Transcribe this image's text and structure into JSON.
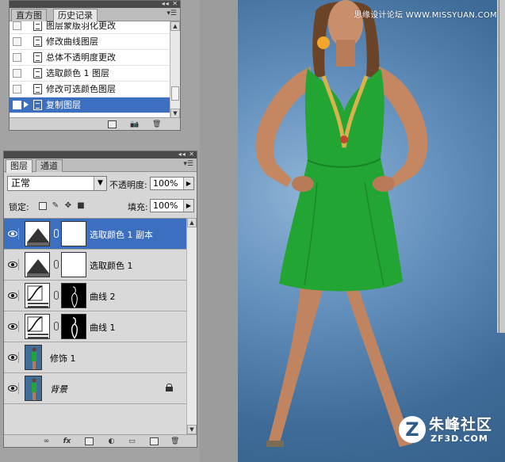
{
  "watermark": {
    "top_text": "思缘设计论坛 WWW.MISSYUAN.COM",
    "logo_letter": "Z",
    "logo_cn": "朱峰社区",
    "logo_url": "ZF3D.COM"
  },
  "history_panel": {
    "tabs": [
      "直方图",
      "历史记录"
    ],
    "active_tab": 1,
    "items": [
      {
        "label": "图层蒙版羽化更改",
        "selected": false
      },
      {
        "label": "修改曲线图层",
        "selected": false
      },
      {
        "label": "总体不透明度更改",
        "selected": false
      },
      {
        "label": "选取颜色 1 图层",
        "selected": false
      },
      {
        "label": "修改可选颜色图层",
        "selected": false
      },
      {
        "label": "复制图层",
        "selected": true
      }
    ],
    "footer_icons": [
      "new-document-from-state-icon",
      "snapshot-camera-icon",
      "trash-icon"
    ]
  },
  "layers_panel": {
    "tabs": [
      "图层",
      "通道"
    ],
    "active_tab": 0,
    "blend_mode": "正常",
    "opacity_label": "不透明度:",
    "opacity_value": "100%",
    "lock_label": "锁定:",
    "fill_label": "填充:",
    "fill_value": "100%",
    "layers": [
      {
        "name": "选取颜色 1 副本",
        "type": "selective-color",
        "selected": true
      },
      {
        "name": "选取颜色 1",
        "type": "selective-color",
        "selected": false
      },
      {
        "name": "曲线 2",
        "type": "curves",
        "selected": false
      },
      {
        "name": "曲线 1",
        "type": "curves",
        "selected": false
      },
      {
        "name": "修饰 1",
        "type": "pixel",
        "selected": false
      },
      {
        "name": "背景",
        "type": "background",
        "selected": false
      }
    ],
    "footer_icons": [
      "link-icon",
      "fx-icon",
      "mask-icon",
      "adjustment-icon",
      "group-folder-icon",
      "new-layer-icon",
      "trash-icon"
    ]
  },
  "colors": {
    "selection_blue": "#3d6fc0",
    "dress_green": "#22a532",
    "backdrop_blue": "#4c7aa8"
  }
}
